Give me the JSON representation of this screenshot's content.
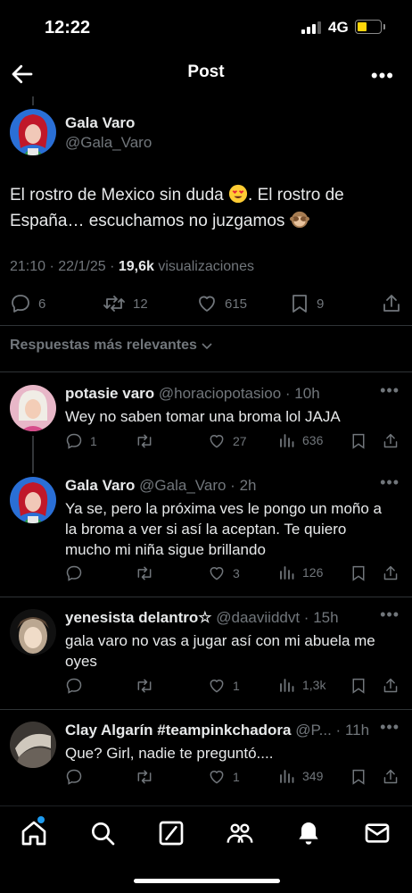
{
  "status_bar": {
    "time": "12:22",
    "network": "4G",
    "battery_color": "#ffd60a"
  },
  "header": {
    "title": "Post",
    "back_icon": "arrow-left-icon",
    "more_icon": "more-icon"
  },
  "post": {
    "author_name": "Gala Varo",
    "author_handle": "@Gala_Varo",
    "text_line1": "El rostro de Mexico sin duda ",
    "text_line1b": ". El rostro de",
    "text_line2": "España… escuchamos no juzgamos ",
    "time": "21:10 · 22/1/25 · ",
    "views_count": "19,6k",
    "views_label": " visualizaciones",
    "replies": "6",
    "reposts": "12",
    "likes": "615",
    "bookmarks": "9"
  },
  "filter_label": "Respuestas más relevantes",
  "replies": [
    {
      "name": "potasie varo",
      "handle": "@horaciopotasioo",
      "time": "10h",
      "text": "Wey no saben tomar una broma lol JAJA",
      "replies": "1",
      "reposts": "",
      "likes": "27",
      "views": "636"
    },
    {
      "name": "Gala Varo",
      "handle": "@Gala_Varo",
      "time": "2h",
      "text": "Ya se, pero la próxima ves le pongo un moño a la broma a ver si así la aceptan. Te quiero mucho mi niña sigue brillando",
      "replies": "",
      "reposts": "",
      "likes": "3",
      "views": "126"
    },
    {
      "name": "yenesista delantro☆",
      "handle": "@daaviiddvt",
      "time": "15h",
      "text": "gala varo no vas a jugar así con mi abuela me oyes",
      "replies": "",
      "reposts": "",
      "likes": "1",
      "views": "1,3k"
    },
    {
      "name": "Clay Algarín #teampinkchadora",
      "handle": "@P...",
      "time": "11h",
      "text": "Que? Girl, nadie te preguntó....",
      "replies": "",
      "reposts": "",
      "likes": "1",
      "views": "349"
    }
  ],
  "colors": {
    "accent": "#1d9bf0",
    "muted": "#71767b",
    "text": "#e7e9ea",
    "divider": "#2f3336"
  },
  "tab_bar": [
    "home-icon",
    "search-icon",
    "compose-icon",
    "communities-icon",
    "notifications-icon",
    "messages-icon"
  ]
}
